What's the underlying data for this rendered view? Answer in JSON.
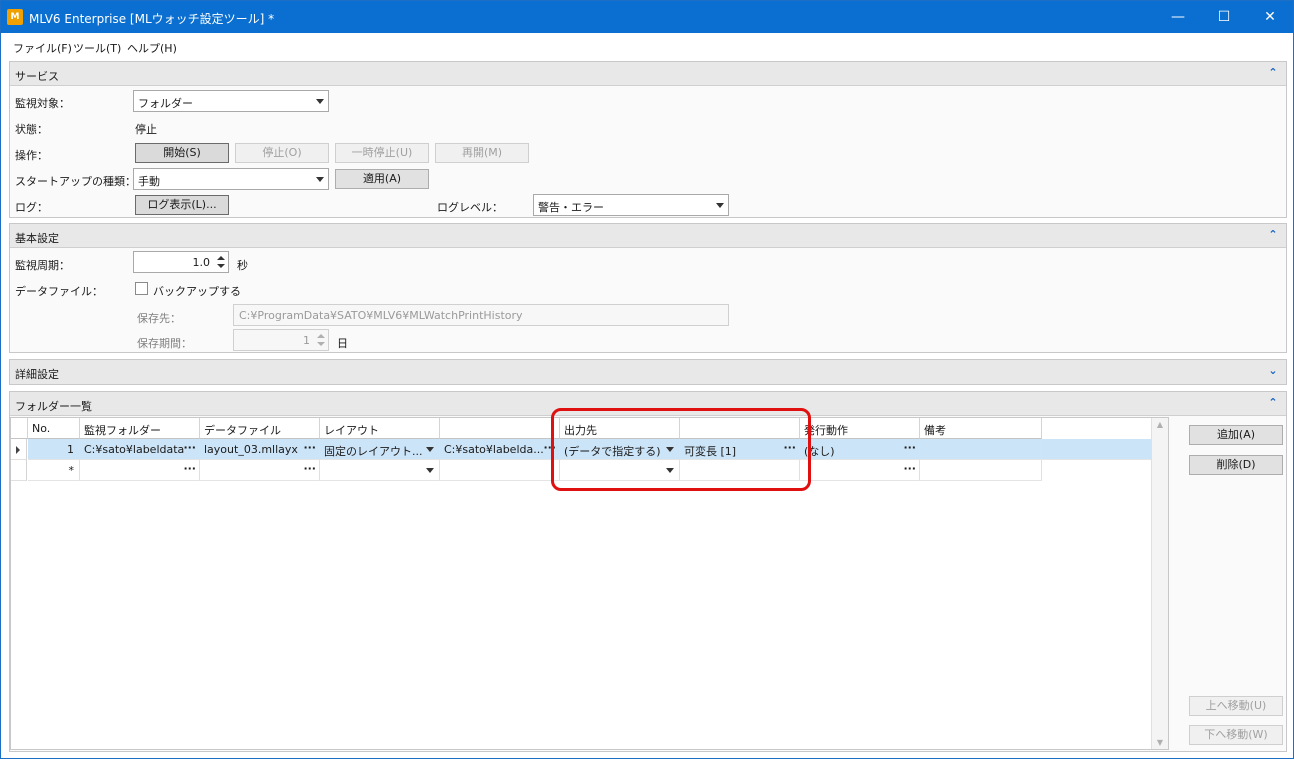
{
  "window": {
    "title": "MLV6 Enterprise [MLウォッチ設定ツール] *",
    "controls": {
      "minimize": "—",
      "maximize": "☐",
      "close": "✕"
    }
  },
  "menu": [
    "ファイル(F)",
    "ツール(T)",
    "ヘルプ(H)"
  ],
  "service": {
    "header": "サービス",
    "chevron": "⌃",
    "target_label": "監視対象：",
    "target_value": "フォルダー",
    "status_label": "状態：",
    "status_value": "停止",
    "operation_label": "操作：",
    "buttons": {
      "start": "開始(S)",
      "stop": "停止(O)",
      "pause": "一時停止(U)",
      "resume": "再開(M)"
    },
    "startup_label": "スタートアップの種類：",
    "startup_value": "手動",
    "apply": "適用(A)",
    "log_label": "ログ：",
    "log_button": "ログ表示(L)...",
    "loglevel_label": "ログレベル：",
    "loglevel_value": "警告・エラー"
  },
  "basic": {
    "header": "基本設定",
    "chevron": "⌃",
    "interval_label": "監視周期：",
    "interval_value": "1.0",
    "interval_unit": "秒",
    "datafile_label": "データファイル：",
    "backup_label": "バックアップする",
    "savepath_label": "保存先：",
    "savepath_value": "C:¥ProgramData¥SATO¥MLV6¥MLWatchPrintHistory",
    "retention_label": "保存期間：",
    "retention_value": "1",
    "retention_unit": "日"
  },
  "advanced": {
    "header": "詳細設定",
    "chevron": "⌄"
  },
  "folders": {
    "header": "フォルダー一覧",
    "chevron": "⌃",
    "columns": [
      "No.",
      "監視フォルダー",
      "データファイル",
      "レイアウト",
      "",
      "出力先",
      "",
      "発行動作",
      "備考"
    ],
    "rows": [
      {
        "no": "1",
        "folder": "C:¥sato¥labeldata",
        "datafile": "layout_03.mllayx",
        "layout": "固定のレイアウト...",
        "path": "C:¥sato¥labelda...",
        "output": "(データで指定する)",
        "output2": "可変長 [1]",
        "action": "(なし)",
        "note": ""
      },
      {
        "no": "*",
        "folder": "",
        "datafile": "",
        "layout": "",
        "path": "",
        "output": "",
        "output2": "",
        "action": "",
        "note": ""
      }
    ],
    "buttons": {
      "add": "追加(A)",
      "delete": "削除(D)",
      "up": "上へ移動(U)",
      "down": "下へ移動(W)"
    }
  }
}
